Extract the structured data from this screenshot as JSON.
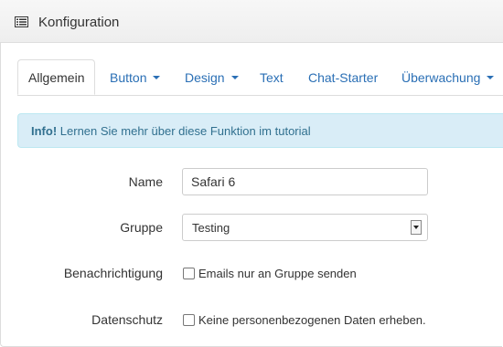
{
  "panel": {
    "title": "Konfiguration",
    "icon": "list-icon"
  },
  "tabs": [
    {
      "label": "Allgemein",
      "active": true
    },
    {
      "label": "Button",
      "dropdown": true
    },
    {
      "label": "Design",
      "dropdown": true
    },
    {
      "label": "Text"
    },
    {
      "label": "Chat-Starter"
    },
    {
      "label": "Überwachung",
      "dropdown": true
    }
  ],
  "alert": {
    "strong": "Info!",
    "text": "Lernen Sie mehr über diese Funktion im tutorial"
  },
  "form": {
    "name_label": "Name",
    "name_value": "Safari 6",
    "gruppe_label": "Gruppe",
    "gruppe_value": "Testing",
    "benachrichtigung_label": "Benachrichtigung",
    "benachrichtigung_option": "Emails nur an Gruppe senden",
    "benachrichtigung_checked": false,
    "datenschutz_label": "Datenschutz",
    "datenschutz_option": "Keine personenbezogenen Daten erheben.",
    "datenschutz_checked": false
  },
  "colors": {
    "link": "#2a6fb5",
    "alert_bg": "#d9edf7",
    "alert_text": "#31708f"
  }
}
